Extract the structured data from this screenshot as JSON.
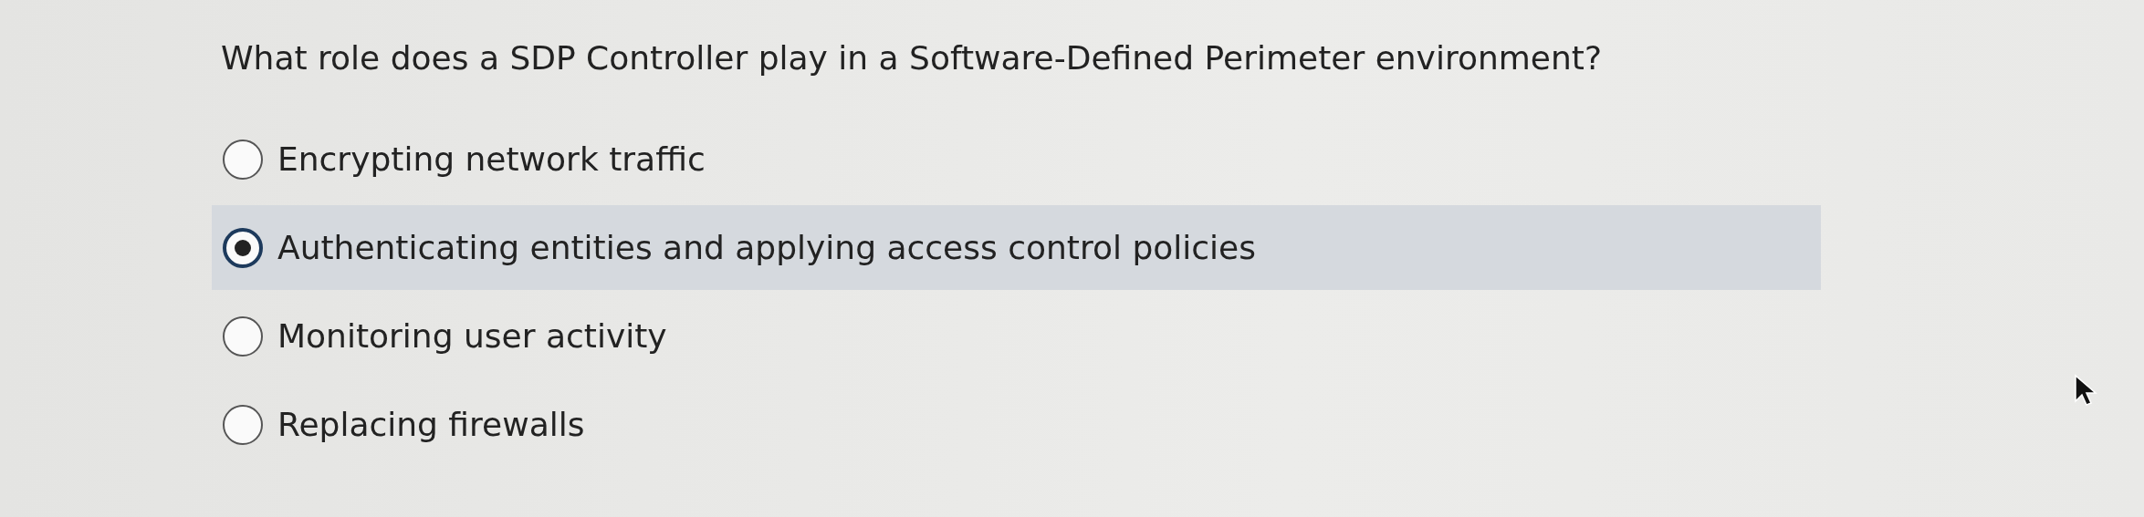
{
  "question": "What role does a SDP Controller play in a Software-Defined Perimeter environment?",
  "options": [
    {
      "label": "Encrypting network traffic",
      "selected": false
    },
    {
      "label": "Authenticating entities and applying access control policies",
      "selected": true
    },
    {
      "label": "Monitoring user activity",
      "selected": false
    },
    {
      "label": "Replacing firewalls",
      "selected": false
    }
  ]
}
